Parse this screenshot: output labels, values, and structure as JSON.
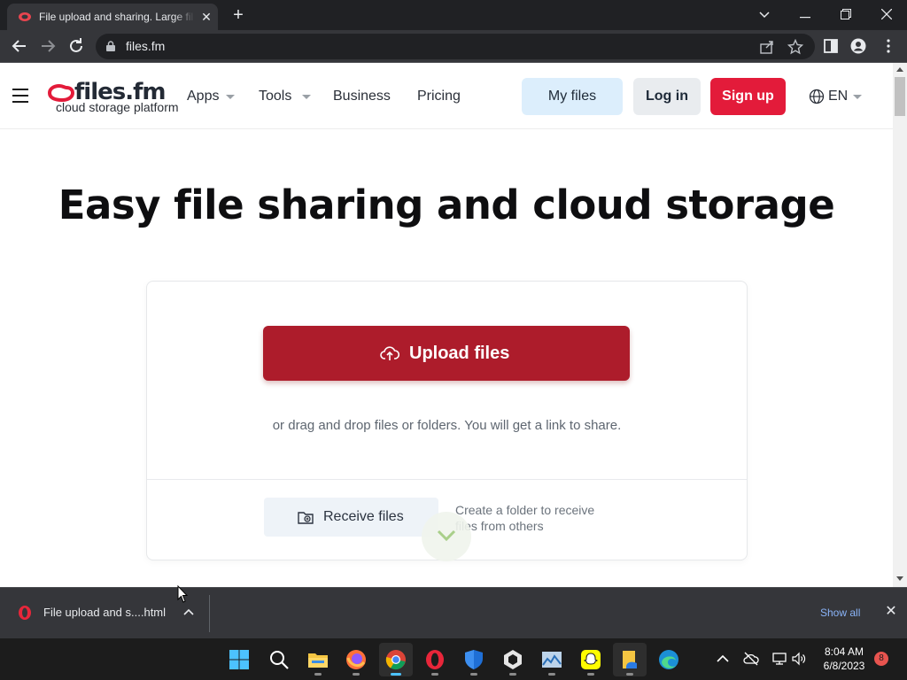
{
  "browser": {
    "tab_title": "File upload and sharing. Large fil",
    "url": "files.fm"
  },
  "site": {
    "logo_name": "files.fm",
    "logo_tagline": "cloud storage platform",
    "nav": {
      "apps": "Apps",
      "tools": "Tools",
      "business": "Business",
      "pricing": "Pricing"
    },
    "buttons": {
      "my_files": "My files",
      "log_in": "Log in",
      "sign_up": "Sign up"
    },
    "language": "EN",
    "hero_title": "Easy file sharing and cloud storage",
    "upload": {
      "button_label": "Upload files",
      "drag_text": "or drag and drop files or folders. You will get a link to share."
    },
    "receive": {
      "button_label": "Receive files",
      "description": "Create a folder to receive files from others"
    },
    "colors": {
      "upload_button": "#ad1c2b",
      "sign_up_button": "#e31b3a",
      "my_files_button": "#dceefc"
    }
  },
  "downloads": {
    "file_name": "File upload and s....html",
    "show_all": "Show all"
  },
  "taskbar": {
    "apps": [
      "start-icon",
      "search-icon",
      "file-explorer-icon",
      "firefox-icon",
      "chrome-icon",
      "opera-icon",
      "defender-icon",
      "unity-icon",
      "photos-icon",
      "snapchat-icon",
      "files-icon",
      "edge-icon"
    ],
    "time": "8:04 AM",
    "date": "6/8/2023",
    "notification_count": "8"
  }
}
